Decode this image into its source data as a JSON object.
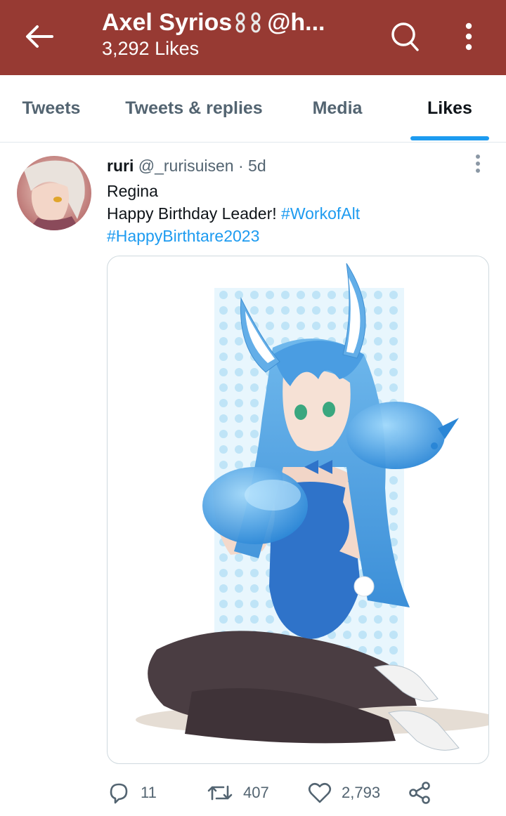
{
  "header": {
    "title": "Axel Syrios",
    "title_suffix": "@h...",
    "subtitle": "3,292 Likes",
    "bg_color": "#973a33"
  },
  "tabs": [
    {
      "label": "Tweets"
    },
    {
      "label": "Tweets & replies"
    },
    {
      "label": "Media"
    },
    {
      "label": "Likes",
      "active": true
    }
  ],
  "tweet": {
    "name": "ruri",
    "handle": "@_rurisuisen",
    "separator": "·",
    "time": "5d",
    "line1": "Regina",
    "line2": "Happy Birthday Leader!",
    "hashtag1": "#WorkofAlt",
    "hashtag2": "#HappyBirthtare2023",
    "media_alt": "Anime illustration of a blue-haired bunny girl holding a blue slime",
    "actions": {
      "reply_count": "11",
      "retweet_count": "407",
      "like_count": "2,793"
    }
  },
  "colors": {
    "accent": "#1d9bf0",
    "muted": "#536471"
  }
}
